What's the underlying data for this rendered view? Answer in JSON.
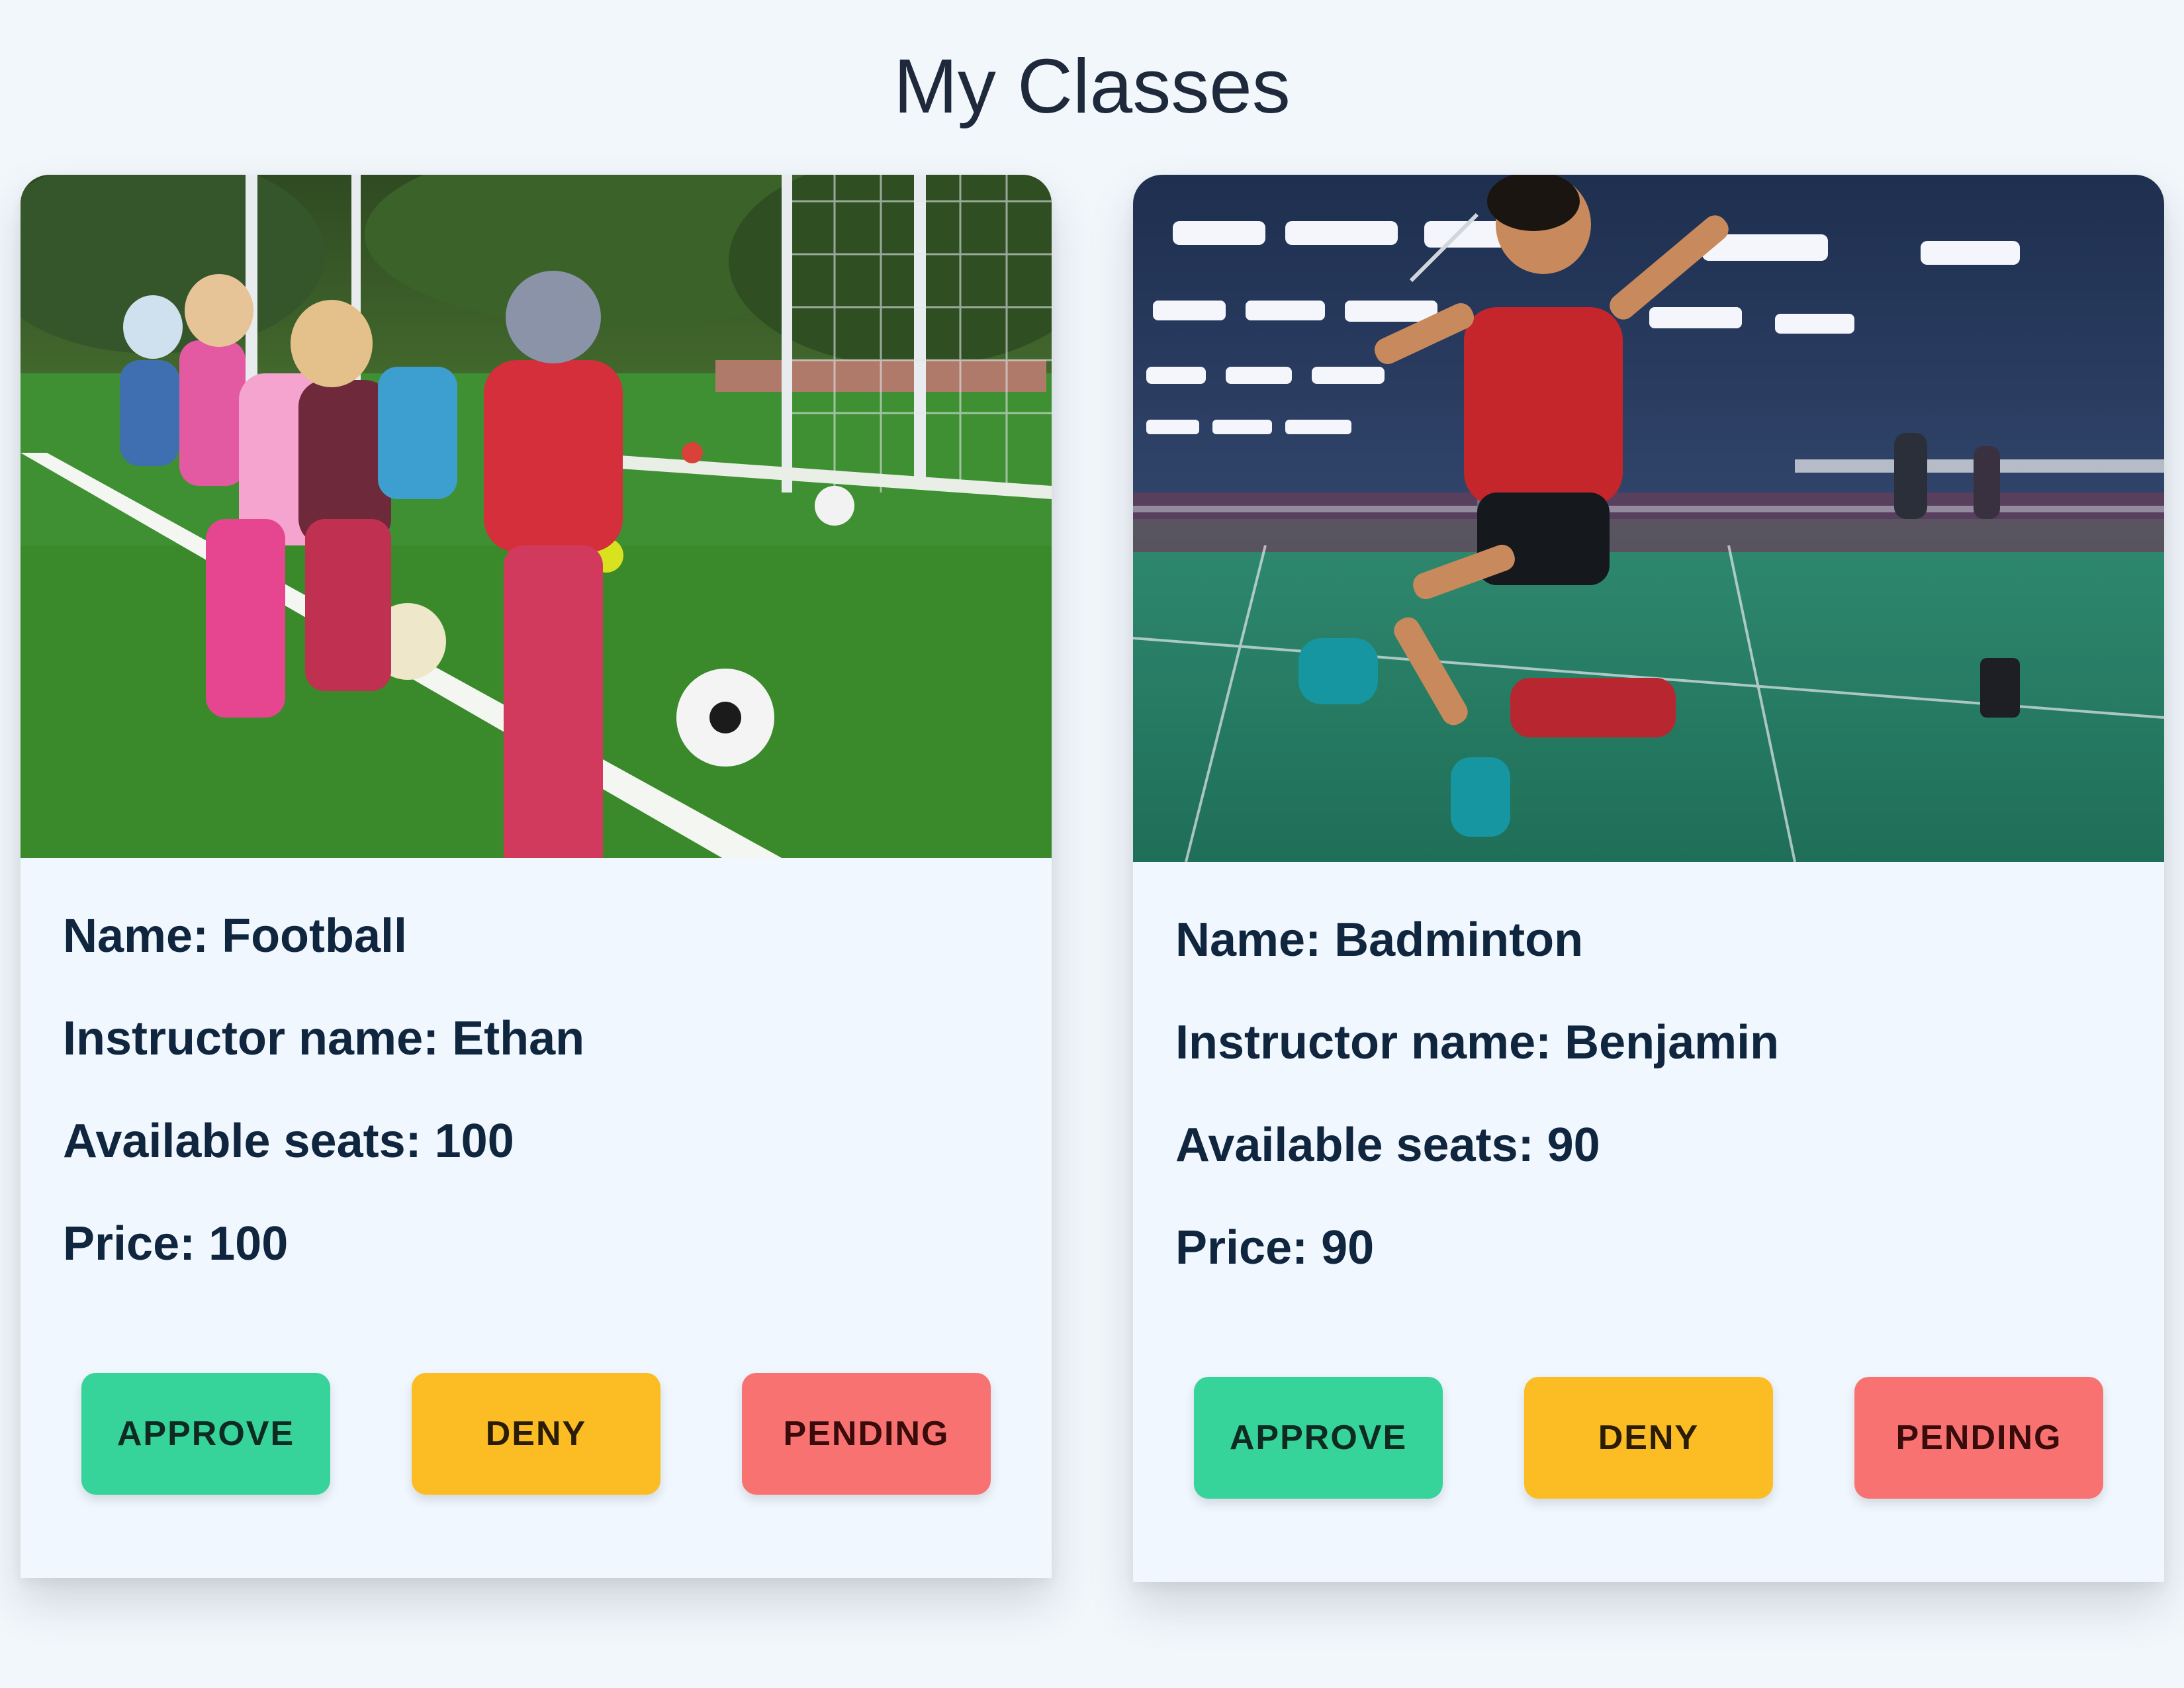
{
  "page": {
    "title": "My Classes"
  },
  "classes": [
    {
      "image_alt": "Kids playing football on a grass field",
      "name_label": "Name: Football",
      "instructor_label": "Instructor name: Ethan",
      "seats_label": "Available seats: 100",
      "price_label": "Price: 100",
      "actions": {
        "approve": "APPROVE",
        "deny": "DENY",
        "pending": "PENDING"
      }
    },
    {
      "image_alt": "Boy jumping to hit a shuttlecock in a badminton hall",
      "name_label": "Name: Badminton",
      "instructor_label": "Instructor name: Benjamin",
      "seats_label": "Available seats: 90",
      "price_label": "Price: 90",
      "actions": {
        "approve": "APPROVE",
        "deny": "DENY",
        "pending": "PENDING"
      }
    }
  ],
  "colors": {
    "background": "#f2f7fc",
    "card": "#f0f7fe",
    "text": "#10263f",
    "approve": "#36d39a",
    "deny": "#fbbd23",
    "pending": "#f87272"
  }
}
